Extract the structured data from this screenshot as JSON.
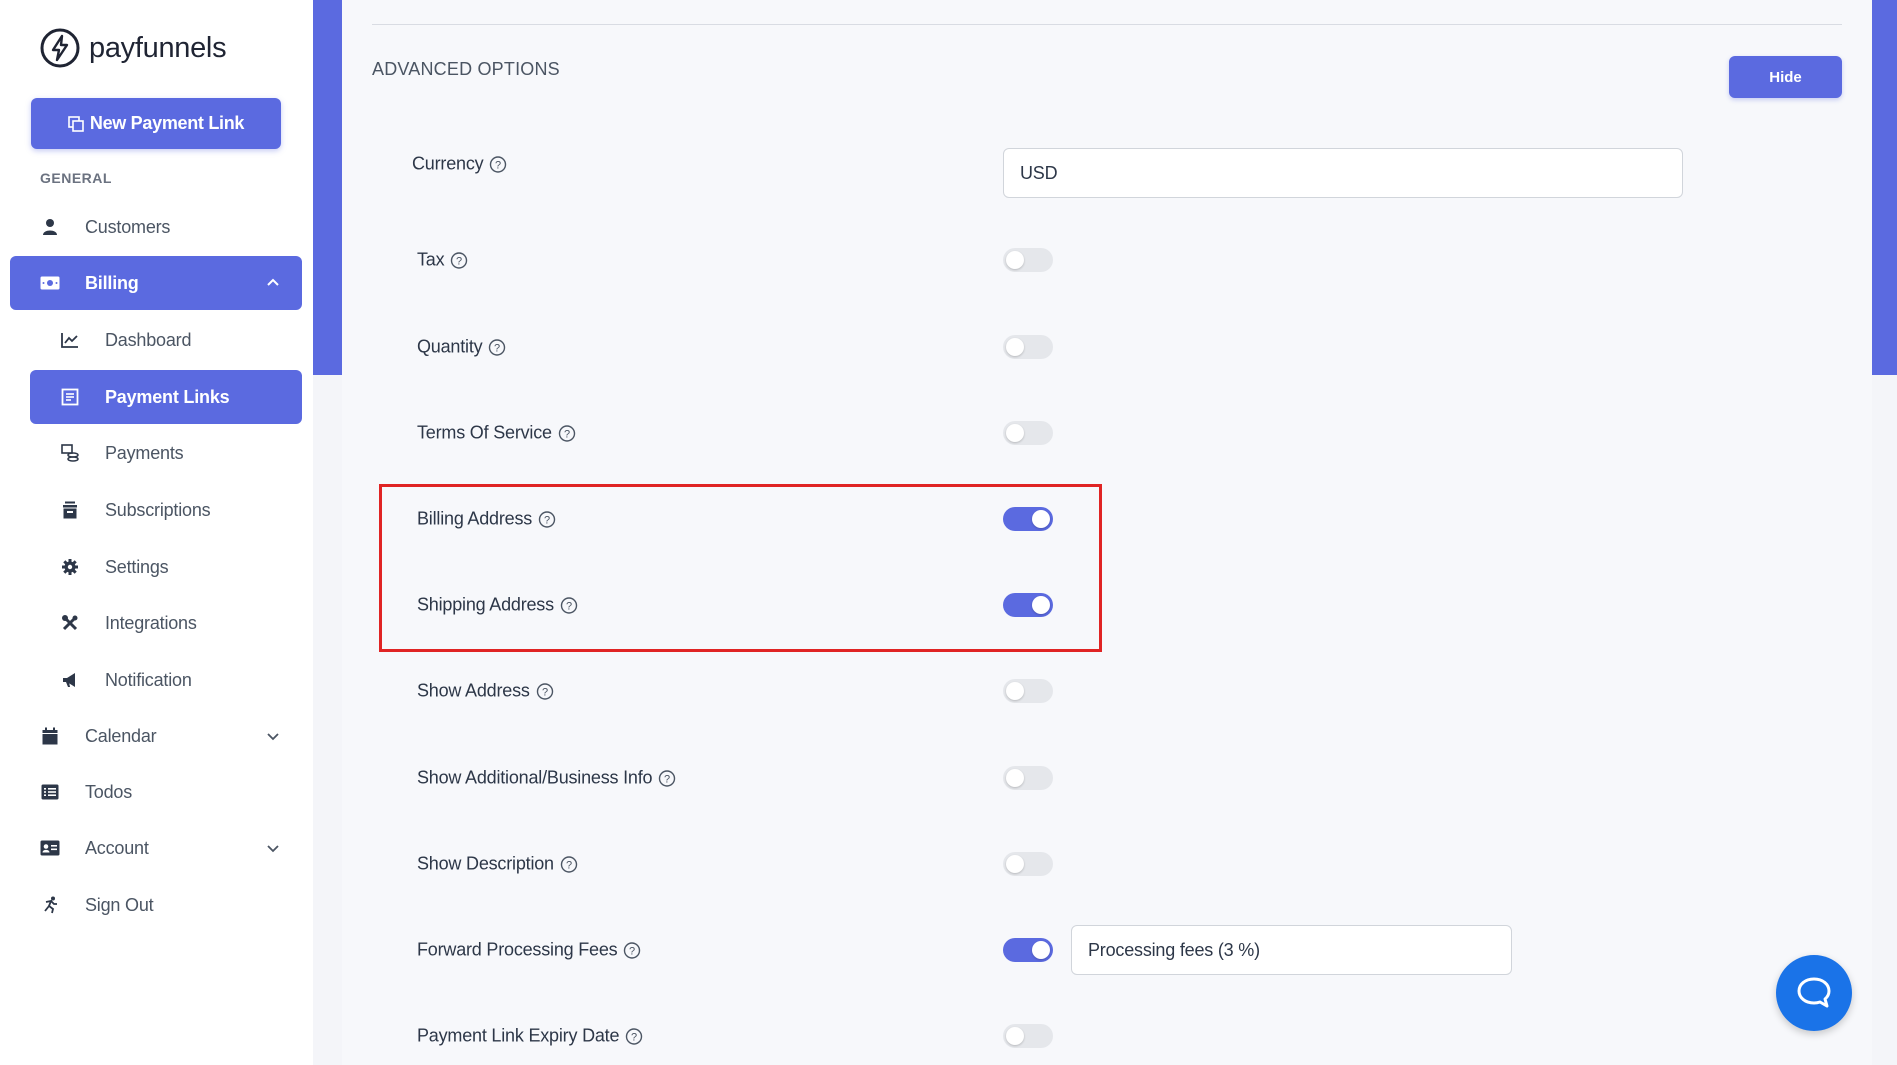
{
  "brand": {
    "name": "payfunnels"
  },
  "sidebar": {
    "new_button": "New Payment Link",
    "section_general": "GENERAL",
    "items": {
      "customers": "Customers",
      "billing": "Billing",
      "dashboard": "Dashboard",
      "payment_links": "Payment Links",
      "payments": "Payments",
      "subscriptions": "Subscriptions",
      "settings": "Settings",
      "integrations": "Integrations",
      "notification": "Notification",
      "calendar": "Calendar",
      "todos": "Todos",
      "account": "Account",
      "sign_out": "Sign Out"
    }
  },
  "advanced": {
    "title": "ADVANCED OPTIONS",
    "hide_button": "Hide",
    "currency": {
      "label": "Currency",
      "value": "USD"
    },
    "options": [
      {
        "label": "Tax",
        "enabled": false
      },
      {
        "label": "Quantity",
        "enabled": false
      },
      {
        "label": "Terms Of Service",
        "enabled": false
      },
      {
        "label": "Billing Address",
        "enabled": true
      },
      {
        "label": "Shipping Address",
        "enabled": true
      },
      {
        "label": "Show Address",
        "enabled": false
      },
      {
        "label": "Show Additional/Business Info",
        "enabled": false
      },
      {
        "label": "Show Description",
        "enabled": false
      },
      {
        "label": "Forward Processing Fees",
        "enabled": true,
        "input_value": "Processing fees (3 %)"
      },
      {
        "label": "Payment Link Expiry Date",
        "enabled": false
      }
    ]
  },
  "colors": {
    "accent": "#5b6ae0",
    "highlight": "#e02424",
    "chat": "#1a73e8"
  }
}
